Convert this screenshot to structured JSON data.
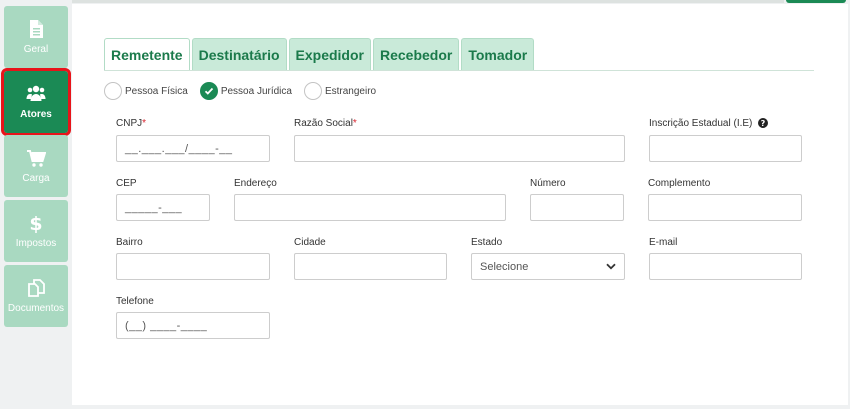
{
  "sidebar": {
    "items": [
      {
        "label": "Geral",
        "icon": "document-icon",
        "active": false
      },
      {
        "label": "Atores",
        "icon": "users-icon",
        "active": true
      },
      {
        "label": "Carga",
        "icon": "cart-icon",
        "active": false
      },
      {
        "label": "Impostos",
        "icon": "dollar-icon",
        "active": false
      },
      {
        "label": "Documentos",
        "icon": "documents-icon",
        "active": false
      }
    ]
  },
  "tabs": [
    {
      "label": "Remetente",
      "active": true
    },
    {
      "label": "Destinatário",
      "active": false
    },
    {
      "label": "Expedidor",
      "active": false
    },
    {
      "label": "Recebedor",
      "active": false
    },
    {
      "label": "Tomador",
      "active": false
    }
  ],
  "person_type": {
    "options": [
      "Pessoa Física",
      "Pessoa Jurídica",
      "Estrangeiro"
    ],
    "selected": "Pessoa Jurídica"
  },
  "form": {
    "cnpj": {
      "label": "CNPJ",
      "required_mark": "*",
      "value": "__.___.___/____-__"
    },
    "razao_social": {
      "label": "Razão Social",
      "required_mark": "*",
      "value": ""
    },
    "ie": {
      "label": "Inscrição Estadual (I.E)",
      "value": ""
    },
    "cep": {
      "label": "CEP",
      "value": "_____-___"
    },
    "endereco": {
      "label": "Endereço",
      "value": ""
    },
    "numero": {
      "label": "Número",
      "value": ""
    },
    "complemento": {
      "label": "Complemento",
      "value": ""
    },
    "bairro": {
      "label": "Bairro",
      "value": ""
    },
    "cidade": {
      "label": "Cidade",
      "value": ""
    },
    "estado": {
      "label": "Estado",
      "value": "Selecione"
    },
    "email": {
      "label": "E-mail",
      "value": ""
    },
    "telefone": {
      "label": "Telefone",
      "value": "(__) ____-____"
    }
  },
  "colors": {
    "accent": "#1b8a55",
    "sidebar_inactive": "#a9d9c1",
    "highlight_border": "#e8141a",
    "tab_bg": "#c9ead9",
    "required": "#d9232d"
  }
}
